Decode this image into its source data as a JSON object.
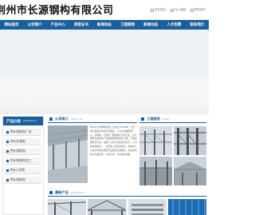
{
  "header": {
    "company_name": "荆州市长源钢构有限公司",
    "links": [
      "设为首页",
      "加入收藏",
      "联系我们"
    ]
  },
  "nav": {
    "items": [
      "网站首页",
      "公司简介",
      "产品中心",
      "资质证书",
      "新闻动态",
      "工程案例",
      "新闻动态",
      "人才招聘",
      "联系我们"
    ]
  },
  "sidebar": {
    "title": "产品分类",
    "title_en": "PRODUCTS",
    "items": [
      "荆州钢结构厂房",
      "荆州彩钢板",
      "荆州钢结构",
      "荆州钢结构加工",
      "荆州C型钢",
      "荆州钢结构"
    ]
  },
  "about": {
    "title": "公司简介",
    "title_en": "ABOUT US",
    "text": "荆州市长源钢构有限公司成立于2005年，位于湖北省荆州市经济开发区，公司主营钢结构厂房、彩钢板、C型钢、钢结构加工等产品。公司拥有先进的生产设备和雄厚的技术力量，产品质量稳定可靠，深受广大客户的信赖与好评。公司本着质量第一、信誉至上的经营宗旨，竭诚为广大客户提供优质的产品和完善的服务。欢迎新老客户莅临指导、洽谈合作，共创美好未来。"
  },
  "project": {
    "title": "工程案例",
    "title_en": "CASE"
  },
  "newest": {
    "title": "最新产品",
    "title_en": "PRODUCTS"
  },
  "colors": {
    "brand": "#1a5f9e",
    "nav_text": "#ffffff"
  }
}
